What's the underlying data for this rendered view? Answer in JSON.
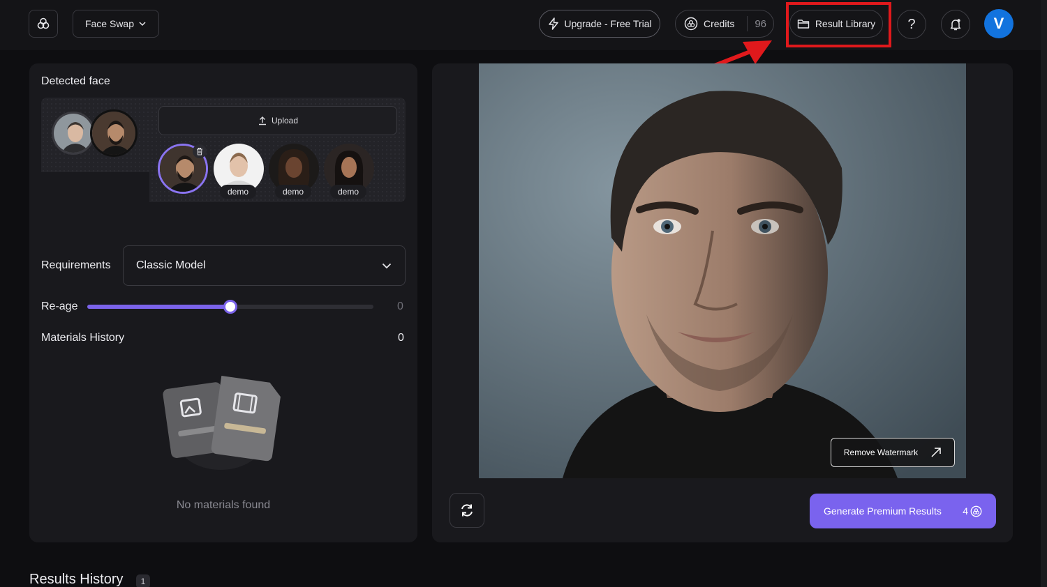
{
  "header": {
    "mode_label": "Face Swap",
    "upgrade_label": "Upgrade - Free Trial",
    "credits_label": "Credits",
    "credits_count": "96",
    "library_label": "Result Library",
    "help_label": "?",
    "avatar_initial": "V"
  },
  "left": {
    "detected_face_label": "Detected face",
    "upload_label": "Upload",
    "demo_labels": [
      "demo",
      "demo",
      "demo"
    ],
    "requirements_label": "Requirements",
    "model_value": "Classic Model",
    "reage_label": "Re-age",
    "reage_value": "0",
    "reage_fraction": 0.5,
    "materials_label": "Materials History",
    "materials_count": "0",
    "empty_text": "No materials found"
  },
  "right": {
    "remove_watermark_label": "Remove Watermark",
    "generate_label": "Generate Premium Results",
    "generate_cost": "4"
  },
  "footer": {
    "results_title": "Results History",
    "results_count": "1"
  },
  "colors": {
    "accent": "#7a63ee",
    "highlight": "#e0191c",
    "avatar": "#1273de"
  }
}
